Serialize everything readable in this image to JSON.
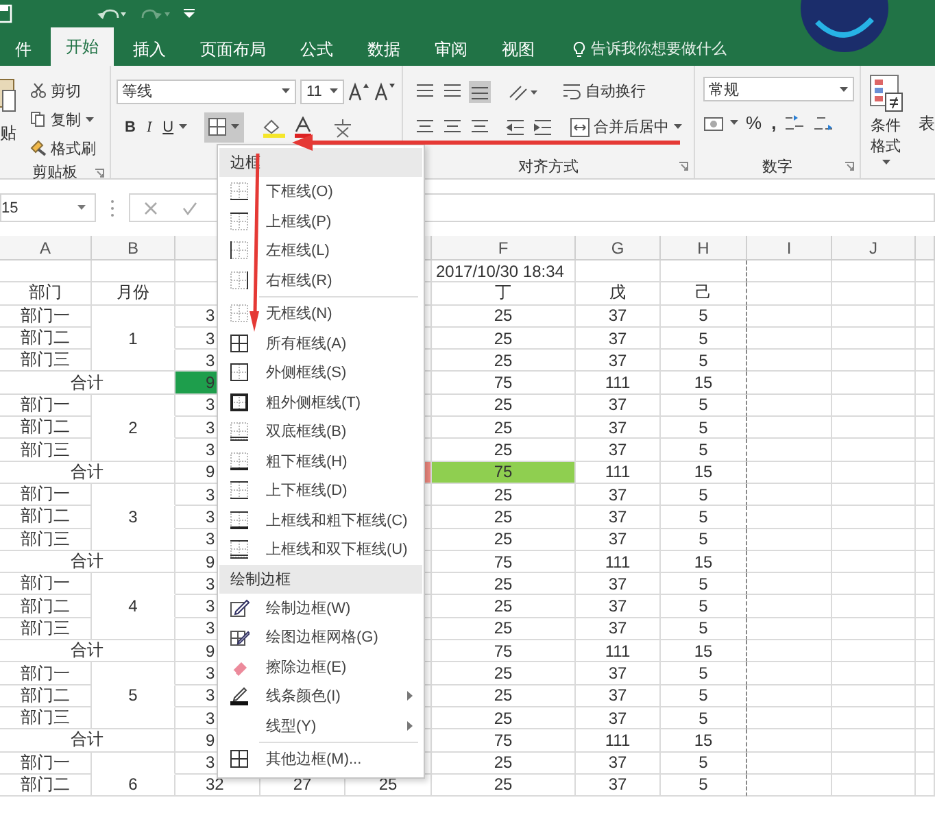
{
  "tabs": [
    {
      "label": "件",
      "selected": false
    },
    {
      "label": "开始",
      "selected": true
    },
    {
      "label": "插入",
      "selected": false
    },
    {
      "label": "页面布局",
      "selected": false
    },
    {
      "label": "公式",
      "selected": false
    },
    {
      "label": "数据",
      "selected": false
    },
    {
      "label": "审阅",
      "selected": false
    },
    {
      "label": "视图",
      "selected": false
    }
  ],
  "tell_me": {
    "placeholder": "告诉我你想要做什么"
  },
  "ribbon": {
    "clipboard": {
      "paste": "贴",
      "cut": "剪切",
      "copy": "复制",
      "format_painter": "格式刷",
      "label": "剪贴板"
    },
    "font": {
      "name": "等线",
      "size": "11",
      "bold": "B",
      "italic": "I",
      "underline": "U"
    },
    "alignment": {
      "wrap_text": "自动换行",
      "merge_center": "合并后居中",
      "label": "对齐方式"
    },
    "number": {
      "format": "常规",
      "percent": "%",
      "comma": ",",
      "label": "数字"
    },
    "styles": {
      "conditional_formatting": "条件格式",
      "next_group": "表"
    }
  },
  "formula_bar": {
    "name_box": "15"
  },
  "sheet": {
    "column_headers": {
      "a": "A",
      "b": "B",
      "f": "F",
      "g": "G",
      "h": "H",
      "i": "I",
      "j": "J"
    },
    "rows": [
      {
        "kind": "date",
        "f": "2017/10/30 18:34"
      },
      {
        "kind": "header",
        "a": "部门",
        "b": "月份",
        "f": "丁",
        "g": "戊",
        "h": "己"
      },
      {
        "kind": "dept",
        "a": "部门一",
        "c": "3",
        "f": "25",
        "g": "37",
        "h": "5"
      },
      {
        "kind": "dept",
        "a": "部门二",
        "b": "1",
        "c": "3",
        "f": "25",
        "g": "37",
        "h": "5"
      },
      {
        "kind": "dept",
        "a": "部门三",
        "c": "3",
        "f": "25",
        "g": "37",
        "h": "5"
      },
      {
        "kind": "total",
        "ab": "合计",
        "c": {
          "text": "9",
          "color": "#1e9e4c"
        },
        "f": "75",
        "g": "111",
        "h": "15"
      },
      {
        "kind": "dept",
        "a": "部门一",
        "c": "3",
        "f": "25",
        "g": "37",
        "h": "5"
      },
      {
        "kind": "dept",
        "a": "部门二",
        "b": "2",
        "c": "3",
        "f": "25",
        "g": "37",
        "h": "5"
      },
      {
        "kind": "dept",
        "a": "部门三",
        "c": "3",
        "f": "25",
        "g": "37",
        "h": "5"
      },
      {
        "kind": "total",
        "ab": "合计",
        "c": "9",
        "e": {
          "color": "#f08a80"
        },
        "f": {
          "text": "75",
          "color": "#8fcf50"
        },
        "g": "111",
        "h": "15"
      },
      {
        "kind": "dept",
        "a": "部门一",
        "c": "3",
        "f": "25",
        "g": "37",
        "h": "5"
      },
      {
        "kind": "dept",
        "a": "部门二",
        "b": "3",
        "c": "3",
        "f": "25",
        "g": "37",
        "h": "5"
      },
      {
        "kind": "dept",
        "a": "部门三",
        "c": "3",
        "f": "25",
        "g": "37",
        "h": "5"
      },
      {
        "kind": "total",
        "ab": "合计",
        "c": "9",
        "f": "75",
        "g": "111",
        "h": "15"
      },
      {
        "kind": "dept",
        "a": "部门一",
        "c": "3",
        "f": "25",
        "g": "37",
        "h": "5"
      },
      {
        "kind": "dept",
        "a": "部门二",
        "b": "4",
        "c": "3",
        "f": "25",
        "g": "37",
        "h": "5"
      },
      {
        "kind": "dept",
        "a": "部门三",
        "c": "3",
        "f": "25",
        "g": "37",
        "h": "5"
      },
      {
        "kind": "total",
        "ab": "合计",
        "c": "9",
        "f": "75",
        "g": "111",
        "h": "15"
      },
      {
        "kind": "dept",
        "a": "部门一",
        "c": "3",
        "f": "25",
        "g": "37",
        "h": "5"
      },
      {
        "kind": "dept",
        "a": "部门二",
        "b": "5",
        "c": "3",
        "f": "25",
        "g": "37",
        "h": "5"
      },
      {
        "kind": "dept",
        "a": "部门三",
        "c": "3",
        "f": "25",
        "g": "37",
        "h": "5"
      },
      {
        "kind": "total",
        "ab": "合计",
        "c": "9",
        "f": "75",
        "g": "111",
        "h": "15"
      },
      {
        "kind": "dept",
        "a": "部门一",
        "c": "3",
        "f": "25",
        "g": "37",
        "h": "5"
      },
      {
        "kind": "dept",
        "a": "部门二",
        "b": "6",
        "c": "32",
        "d": "27",
        "e": "25",
        "f": "25",
        "g": "37",
        "h": "5"
      }
    ]
  },
  "border_menu": {
    "items": [
      {
        "kind": "section",
        "label": "边框"
      },
      {
        "kind": "item",
        "label": "下框线(O)",
        "submenu": false
      },
      {
        "kind": "item",
        "label": "上框线(P)",
        "submenu": false
      },
      {
        "kind": "item",
        "label": "左框线(L)",
        "submenu": false
      },
      {
        "kind": "item",
        "label": "右框线(R)",
        "submenu": false
      },
      {
        "kind": "separator"
      },
      {
        "kind": "item",
        "label": "无框线(N)",
        "submenu": false
      },
      {
        "kind": "item",
        "label": "所有框线(A)",
        "submenu": false
      },
      {
        "kind": "item",
        "label": "外侧框线(S)",
        "submenu": false
      },
      {
        "kind": "item",
        "label": "粗外侧框线(T)",
        "submenu": false
      },
      {
        "kind": "item",
        "label": "双底框线(B)",
        "submenu": false
      },
      {
        "kind": "item",
        "label": "粗下框线(H)",
        "submenu": false
      },
      {
        "kind": "item",
        "label": "上下框线(D)",
        "submenu": false
      },
      {
        "kind": "item",
        "label": "上框线和粗下框线(C)",
        "submenu": false
      },
      {
        "kind": "item",
        "label": "上框线和双下框线(U)",
        "submenu": false
      },
      {
        "kind": "section",
        "label": "绘制边框"
      },
      {
        "kind": "item",
        "label": "绘制边框(W)",
        "submenu": false
      },
      {
        "kind": "item",
        "label": "绘图边框网格(G)",
        "submenu": false
      },
      {
        "kind": "item",
        "label": "擦除边框(E)",
        "submenu": false
      },
      {
        "kind": "item",
        "label": "线条颜色(I)",
        "submenu": true
      },
      {
        "kind": "item",
        "label": "线型(Y)",
        "submenu": true
      },
      {
        "kind": "separator"
      },
      {
        "kind": "item",
        "label": "其他边框(M)...",
        "submenu": false
      }
    ]
  }
}
